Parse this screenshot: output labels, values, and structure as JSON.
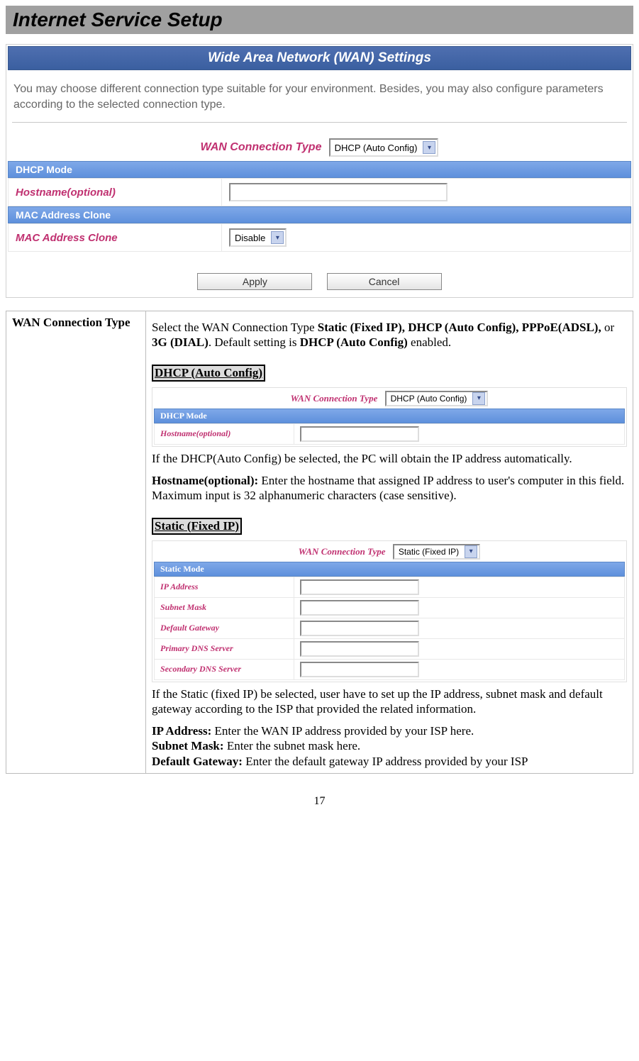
{
  "doc": {
    "title": "Internet Service Setup",
    "page_number": "17"
  },
  "main_figure": {
    "banner": "Wide Area Network (WAN) Settings",
    "help": "You may choose different connection type suitable for your environment. Besides, you may also configure parameters according to the selected connection type.",
    "conn_label": "WAN Connection Type",
    "conn_value": "DHCP (Auto Config)",
    "sect_dhcp": "DHCP Mode",
    "hostname_label": "Hostname(optional)",
    "sect_mac": "MAC Address Clone",
    "mac_label": "MAC Address Clone",
    "mac_value": "Disable",
    "btn_apply": "Apply",
    "btn_cancel": "Cancel"
  },
  "table_col1": "WAN Connection Type",
  "desc": {
    "intro_pre": "Select the WAN Connection Type ",
    "intro_bold1": "Static (Fixed IP), DHCP (Auto Config), PPPoE(ADSL),",
    "intro_mid": " or ",
    "intro_bold2": "3G (DIAL)",
    "intro_mid2": ". Default setting is ",
    "intro_bold3": "DHCP (Auto Config)",
    "intro_end": " enabled.",
    "sub_dhcp": "DHCP (Auto Config)",
    "dhcp_text": "If the DHCP(Auto Config) be selected, the PC will obtain the IP address automatically.",
    "hostname_label": "Hostname(optional):",
    "hostname_text": " Enter the hostname that assigned IP address to user's computer in this field. Maximum input is 32 alphanumeric characters (case sensitive).",
    "sub_static": "Static (Fixed IP)",
    "static_text": "If the Static (fixed IP) be selected, user have to set up the IP address, subnet mask and default gateway according to the ISP that provided the related information.",
    "ip_label": "IP Address:",
    "ip_text": " Enter the WAN IP address provided by your ISP here.",
    "sm_label": "Subnet Mask:",
    "sm_text": " Enter the subnet mask here.",
    "gw_label": "Default Gateway:",
    "gw_text": " Enter the default gateway IP address provided by your ISP"
  },
  "mini_dhcp": {
    "conn_label": "WAN Connection Type",
    "conn_value": "DHCP (Auto Config)",
    "sect": "DHCP Mode",
    "hostname_label": "Hostname(optional)"
  },
  "mini_static": {
    "conn_label": "WAN Connection Type",
    "conn_value": "Static (Fixed IP)",
    "sect": "Static Mode",
    "fields": {
      "0": "IP Address",
      "1": "Subnet Mask",
      "2": "Default Gateway",
      "3": "Primary DNS Server",
      "4": "Secondary DNS Server"
    }
  }
}
